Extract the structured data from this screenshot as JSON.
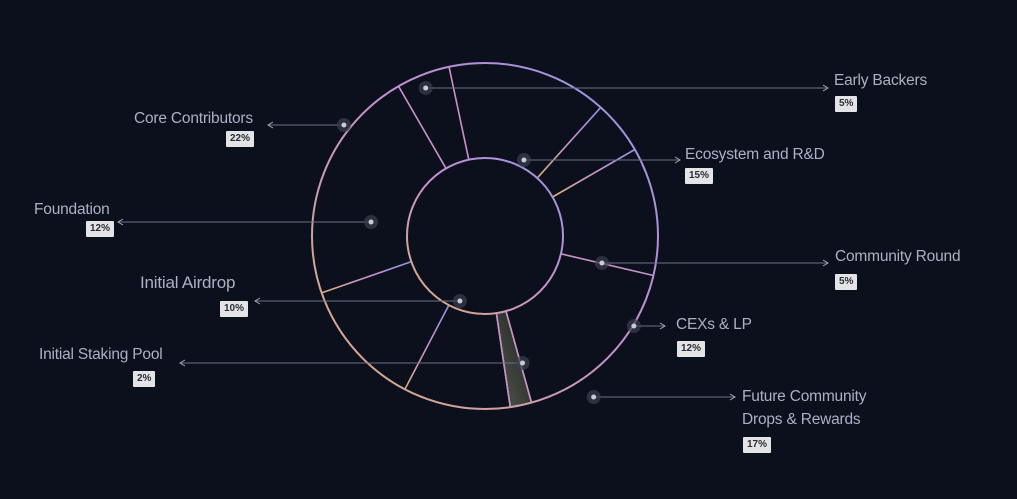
{
  "chart_data": {
    "type": "pie",
    "slices": [
      {
        "name": "Early Backers",
        "value": 5,
        "label": "5%"
      },
      {
        "name": "Ecosystem and R&D",
        "value": 15,
        "label": "15%"
      },
      {
        "name": "Community Round",
        "value": 5,
        "label": "5%"
      },
      {
        "name": "CEXs & LP",
        "value": 12,
        "label": "12%"
      },
      {
        "name": "Future Community Drops & Rewards",
        "value": 17,
        "label": "17%"
      },
      {
        "name": "Initial Staking Pool",
        "value": 2,
        "label": "2%"
      },
      {
        "name": "Initial Airdrop",
        "value": 10,
        "label": "10%"
      },
      {
        "name": "Foundation",
        "value": 12,
        "label": "12%"
      },
      {
        "name": "Core Contributors",
        "value": 22,
        "label": "22%"
      }
    ],
    "donut": true,
    "highlighted_slice": "Initial Staking Pool",
    "colors": {
      "background": "#0c101c",
      "ring_gradient_start": "#d9b07a",
      "ring_gradient_mid": "#c58fd0",
      "ring_gradient_end": "#8f95e0",
      "label_text": "#aab1c6",
      "badge_bg": "#e3e4e6"
    }
  },
  "labels": {
    "early_backers": "Early Backers",
    "ecosystem": "Ecosystem and R&D",
    "community_round": "Community Round",
    "cexs": "CEXs & LP",
    "future_line1": "Future Community",
    "future_line2": "Drops & Rewards",
    "staking": "Initial Staking Pool",
    "airdrop": "Initial Airdrop",
    "foundation": "Foundation",
    "core": "Core Contributors"
  }
}
